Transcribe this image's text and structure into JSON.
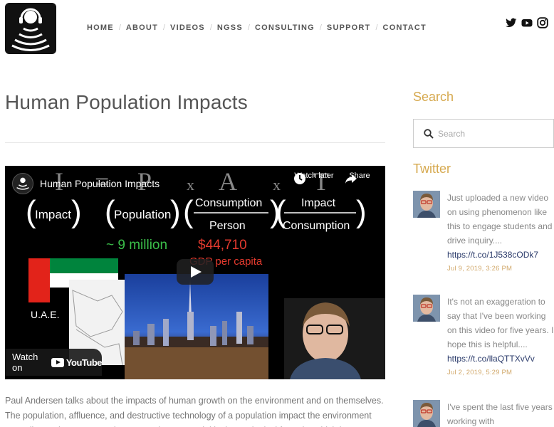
{
  "nav": {
    "items": [
      "HOME",
      "ABOUT",
      "VIDEOS",
      "NGSS",
      "CONSULTING",
      "SUPPORT",
      "CONTACT"
    ]
  },
  "social": [
    "twitter-icon",
    "youtube-icon",
    "instagram-icon"
  ],
  "page": {
    "title": "Human Population Impacts",
    "description": "Paul Andersen talks about the impacts of human growth on the environment and on themselves. The population, affluence, and destructive technology of a population impact the environment according to the IPAT equation. An analogous model is the ecological footprint which increases"
  },
  "video": {
    "title": "Human Population Impacts",
    "watch_later": "Watch later",
    "share": "Share",
    "watch_on": "Watch on",
    "youtube": "YouTube",
    "equation": {
      "letters": [
        "I",
        "=",
        "P",
        "x",
        "A",
        "x",
        "T"
      ],
      "terms": [
        "Impact",
        "Population",
        "Consumption",
        "Person",
        "Impact",
        "Consumption"
      ],
      "population_value": "~ 9 million",
      "gdp_value": "$44,710",
      "gdp_label": "GDP per capita",
      "country": "U.A.E."
    }
  },
  "sidebar": {
    "search_heading": "Search",
    "search_placeholder": "Search",
    "twitter_heading": "Twitter",
    "tweets": [
      {
        "text": "Just uploaded a new video on using phenomenon like this to engage students and drive inquiry....",
        "link": "https://t.co/1J538cODk7",
        "date": "Jul 9, 2019, 3:26 PM"
      },
      {
        "text": "It's not an exaggeration to say that I've been working on this video for five years. I hope this is helpful....",
        "link": "https://t.co/llaQTTXvVv",
        "date": "Jul 2, 2019, 5:29 PM"
      },
      {
        "text": "I've spent the last five years working with",
        "link": "",
        "date": ""
      }
    ]
  },
  "colors": {
    "accent": "#d6a94f",
    "link": "#2a3a6a",
    "equation_green": "#3bbf4a",
    "equation_red": "#e43a2e"
  }
}
